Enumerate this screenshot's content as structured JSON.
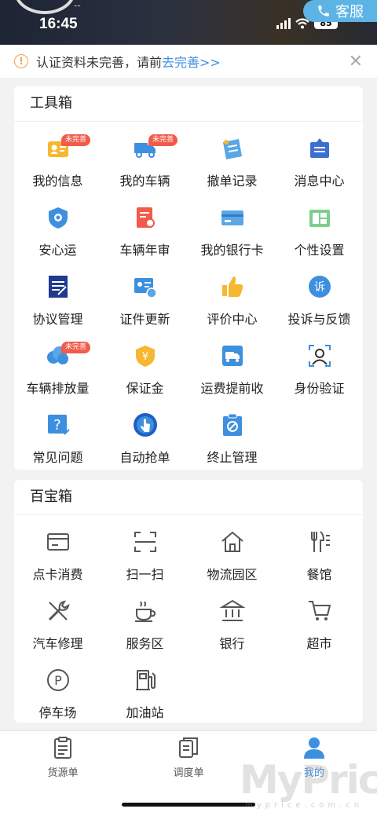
{
  "status_bar": {
    "time": "16:45",
    "battery": "85"
  },
  "header": {
    "user_name": "--",
    "service_label": "客服"
  },
  "notice": {
    "text": "认证资料未完善，请前",
    "link": "去完善>>"
  },
  "toolbox": {
    "title": "工具箱",
    "items": [
      {
        "label": "我的信息",
        "icon": "profile-card-icon",
        "badge": "未完善"
      },
      {
        "label": "我的车辆",
        "icon": "truck-icon",
        "badge": "未完善"
      },
      {
        "label": "撤单记录",
        "icon": "cancel-record-icon",
        "badge": ""
      },
      {
        "label": "消息中心",
        "icon": "message-icon",
        "badge": ""
      },
      {
        "label": "安心运",
        "icon": "shield-icon",
        "badge": ""
      },
      {
        "label": "车辆年审",
        "icon": "inspection-icon",
        "badge": ""
      },
      {
        "label": "我的银行卡",
        "icon": "bank-card-icon",
        "badge": ""
      },
      {
        "label": "个性设置",
        "icon": "settings-icon",
        "badge": ""
      },
      {
        "label": "协议管理",
        "icon": "agreement-icon",
        "badge": ""
      },
      {
        "label": "证件更新",
        "icon": "id-update-icon",
        "badge": ""
      },
      {
        "label": "评价中心",
        "icon": "thumbs-up-icon",
        "badge": ""
      },
      {
        "label": "投诉与反馈",
        "icon": "complaint-icon",
        "badge": ""
      },
      {
        "label": "车辆排放量",
        "icon": "emission-icon",
        "badge": "未完善"
      },
      {
        "label": "保证金",
        "icon": "deposit-icon",
        "badge": ""
      },
      {
        "label": "运费提前收",
        "icon": "freight-advance-icon",
        "badge": ""
      },
      {
        "label": "身份验证",
        "icon": "face-verify-icon",
        "badge": ""
      },
      {
        "label": "常见问题",
        "icon": "faq-icon",
        "badge": ""
      },
      {
        "label": "自动抢单",
        "icon": "auto-grab-icon",
        "badge": ""
      },
      {
        "label": "终止管理",
        "icon": "terminate-icon",
        "badge": ""
      }
    ]
  },
  "treasure": {
    "title": "百宝箱",
    "items": [
      {
        "label": "点卡消费",
        "icon": "card-icon"
      },
      {
        "label": "扫一扫",
        "icon": "scan-icon"
      },
      {
        "label": "物流园区",
        "icon": "home-icon"
      },
      {
        "label": "餐馆",
        "icon": "restaurant-icon"
      },
      {
        "label": "汽车修理",
        "icon": "repair-icon"
      },
      {
        "label": "服务区",
        "icon": "coffee-icon"
      },
      {
        "label": "银行",
        "icon": "bank-icon"
      },
      {
        "label": "超市",
        "icon": "cart-icon"
      },
      {
        "label": "停车场",
        "icon": "parking-icon"
      },
      {
        "label": "加油站",
        "icon": "gas-station-icon"
      }
    ]
  },
  "tabbar": {
    "items": [
      {
        "label": "货源单",
        "icon": "clipboard-icon"
      },
      {
        "label": "调度单",
        "icon": "documents-icon"
      },
      {
        "label": "我的",
        "icon": "user-icon"
      }
    ],
    "active_index": 2
  },
  "watermark": {
    "text": "MyPrice",
    "sub": "myprice.com.cn"
  },
  "colors": {
    "accent": "#3d8fe0",
    "badge": "#f25b4a",
    "warning": "#f0a050",
    "service": "#5eb3e5"
  }
}
